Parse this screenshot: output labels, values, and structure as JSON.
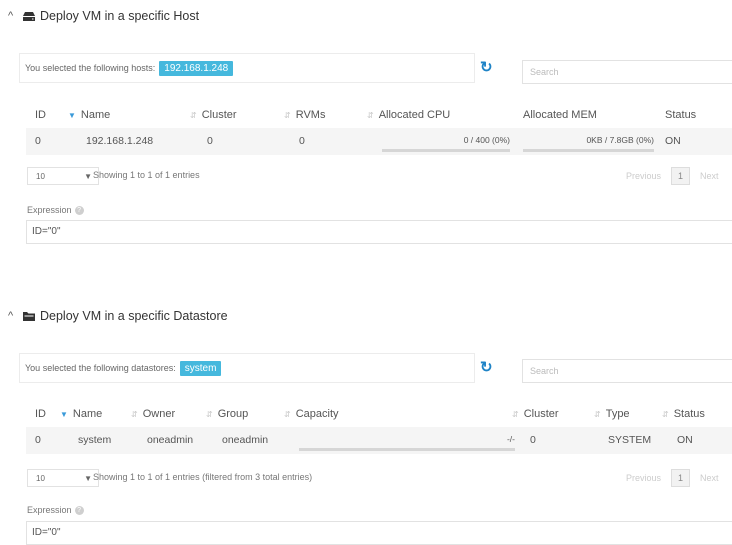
{
  "host_section": {
    "title": "Deploy VM in a specific Host",
    "selected_label": "You selected the following hosts:",
    "selected_tag": "192.168.1.248",
    "search_placeholder": "Search",
    "columns": [
      "ID",
      "Name",
      "Cluster",
      "RVMs",
      "Allocated CPU",
      "Allocated MEM",
      "Status"
    ],
    "rows": [
      {
        "id": "0",
        "name": "192.168.1.248",
        "cluster": "0",
        "rvms": "0",
        "cpu": "0 / 400 (0%)",
        "cpu_fraction": 0,
        "mem": "0KB / 7.8GB (0%)",
        "mem_fraction": 0,
        "status": "ON"
      }
    ],
    "length_value": "10",
    "info": "Showing 1 to 1 of 1 entries",
    "pager": {
      "previous": "Previous",
      "page": "1",
      "next": "Next"
    },
    "expression_label": "Expression",
    "expression_value": "ID=\"0\""
  },
  "datastore_section": {
    "title": "Deploy VM in a specific Datastore",
    "selected_label": "You selected the following datastores:",
    "selected_tag": "system",
    "search_placeholder": "Search",
    "columns": [
      "ID",
      "Name",
      "Owner",
      "Group",
      "Capacity",
      "Cluster",
      "Type",
      "Status"
    ],
    "rows": [
      {
        "id": "0",
        "name": "system",
        "owner": "oneadmin",
        "group": "oneadmin",
        "capacity": "-/-",
        "capacity_fraction": 0,
        "cluster": "0",
        "type": "SYSTEM",
        "status": "ON"
      }
    ],
    "length_value": "10",
    "info": "Showing 1 to 1 of 1 entries (filtered from 3 total entries)",
    "pager": {
      "previous": "Previous",
      "page": "1",
      "next": "Next"
    },
    "expression_label": "Expression",
    "expression_value": "ID=\"0\""
  },
  "icons": {
    "collapse": "chevron-up-icon",
    "host": "server-icon",
    "datastore": "folder-icon",
    "refresh": "refresh-icon",
    "help": "help-icon"
  },
  "colors": {
    "tag": "#45b8dd",
    "refresh": "#1e83c6",
    "sort_active": "#3a9ad9"
  }
}
